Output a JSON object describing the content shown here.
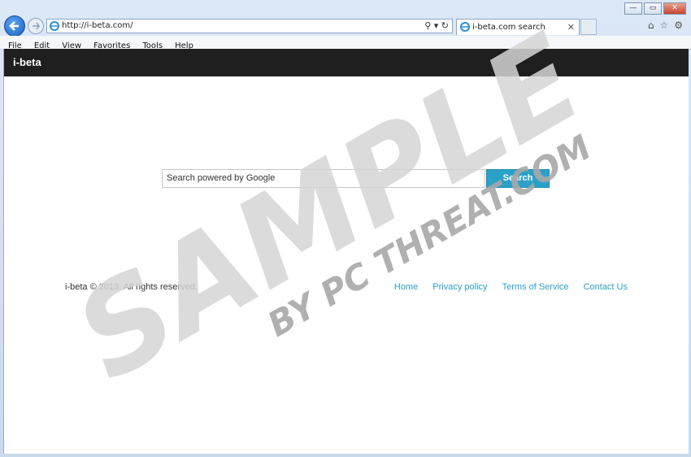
{
  "browser": {
    "address_url": "http://i-beta.com/",
    "tab_title": "i-beta.com search",
    "menu": [
      "File",
      "Edit",
      "View",
      "Favorites",
      "Tools",
      "Help"
    ]
  },
  "site": {
    "brand": "i-beta",
    "search_placeholder": "Search powered by Google",
    "search_button": "Search",
    "copyright": "i-beta © 2013. All rights reserved.",
    "footer_links": [
      "Home",
      "Privacy policy",
      "Terms of Service",
      "Contact Us"
    ]
  },
  "watermark": {
    "line1": "SAMPLE",
    "line2": "BY PC THREAT.COM"
  },
  "colors": {
    "accent": "#2ba1ca",
    "header_bar": "#1f1f1f"
  }
}
